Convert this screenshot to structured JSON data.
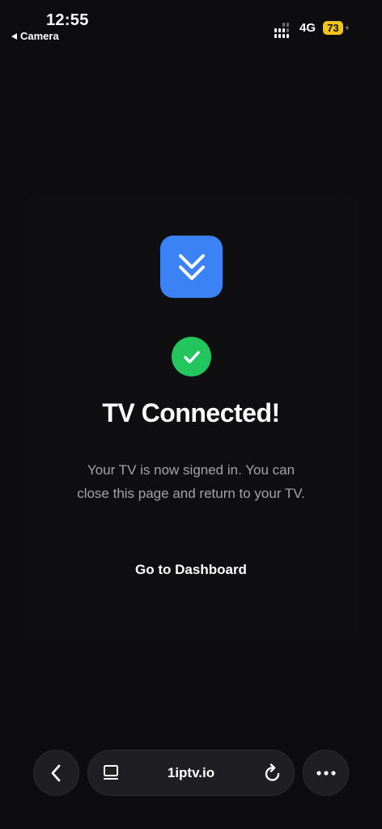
{
  "status_bar": {
    "time": "12:55",
    "back_app_label": "Camera",
    "network": "4G",
    "battery": "73"
  },
  "page": {
    "title": "TV Connected!",
    "message": "Your TV is now signed in. You can close this page and return to your TV.",
    "dashboard_link": "Go to Dashboard"
  },
  "browser": {
    "url": "1iptv.io"
  },
  "icons": {
    "app_logo": "double-chevron-down-icon",
    "success": "checkmark-icon",
    "back": "chevron-left-icon",
    "tabs": "tabs-icon",
    "reload": "reload-icon",
    "more": "more-dots-icon"
  },
  "colors": {
    "background": "#0d0d10",
    "brand_blue": "#3b82f6",
    "success_green": "#22c55e",
    "battery_yellow": "#f2c31b",
    "muted_text": "#a3a3a9"
  }
}
